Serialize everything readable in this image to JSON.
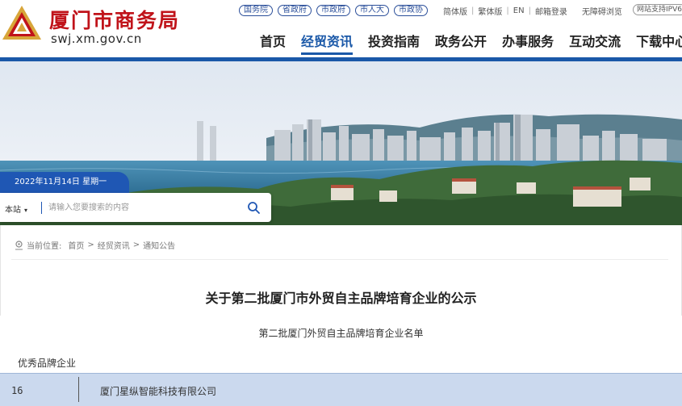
{
  "header": {
    "site_name": "厦门市商务局",
    "domain": "swj.xm.gov.cn",
    "gov_links": [
      "国务院",
      "省政府",
      "市政府",
      "市人大",
      "市政协"
    ],
    "utility_links": [
      "简体版",
      "繁体版",
      "EN",
      "邮箱登录"
    ],
    "accessibility": "无障碍浏览",
    "ipv6_badge": "网站支持IPV6"
  },
  "nav": {
    "items": [
      "首页",
      "经贸资讯",
      "投资指南",
      "政务公开",
      "办事服务",
      "互动交流",
      "下载中心"
    ],
    "active": "经贸资讯"
  },
  "banner": {
    "date": "2022年11月14日 星期一",
    "search_scope": "本站",
    "search_placeholder": "请输入您要搜索的内容"
  },
  "breadcrumb": {
    "label": "当前位置:",
    "items": [
      "首页",
      "经贸资讯",
      "通知公告"
    ]
  },
  "article": {
    "title": "关于第二批厦门市外贸自主品牌培育企业的公示",
    "list_heading": "第二批厦门外贸自主品牌培育企业名单",
    "section_label": "优秀品牌企业",
    "rows": [
      {
        "number": "16",
        "company": "厦门星纵智能科技有限公司"
      }
    ]
  },
  "colors": {
    "brand_red": "#c0131a",
    "primary_blue": "#1a58a8",
    "row_highlight": "#cbd9ee"
  },
  "icons": [
    "logo-emblem",
    "caret-down-icon",
    "search-icon",
    "location-pin-icon"
  ]
}
